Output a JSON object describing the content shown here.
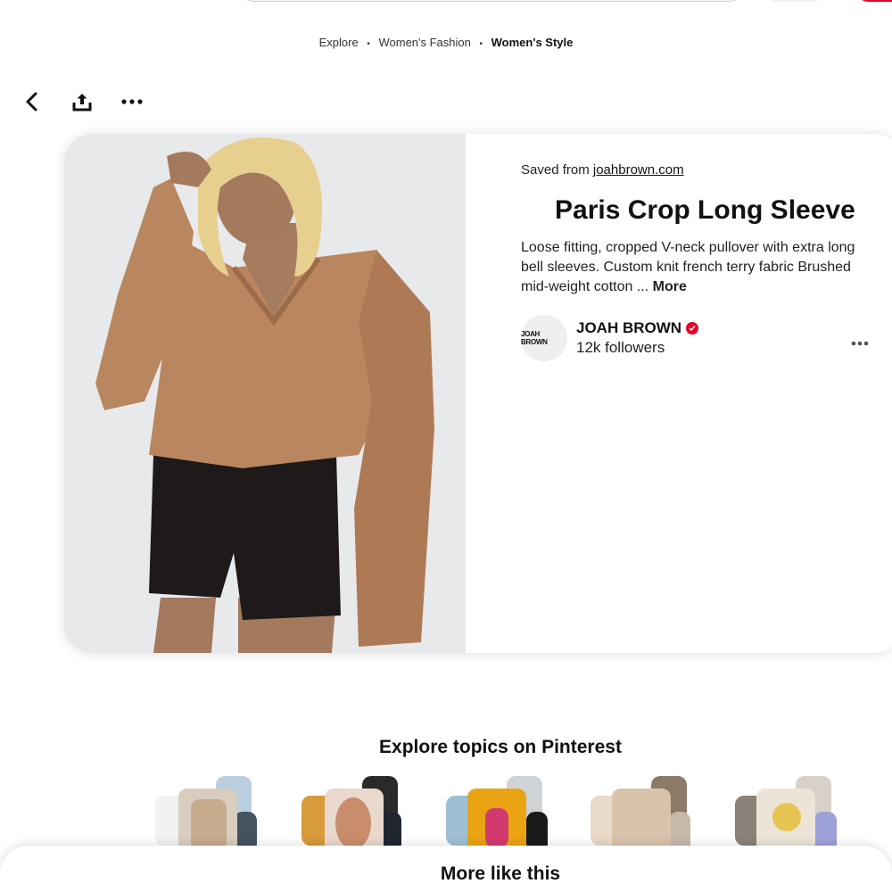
{
  "breadcrumb": {
    "items": [
      "Explore",
      "Women's Fashion"
    ],
    "current": "Women's Style"
  },
  "pin": {
    "saved_prefix": "Saved from",
    "source": "joahbrown.com",
    "title": "Paris Crop Long Sleeve",
    "description": "Loose fitting, cropped V-neck pullover with extra long bell sleeves. Custom knit french terry fabric Brushed mid-weight cotton ...",
    "more_label": "More"
  },
  "creator": {
    "avatar_text": "JOAH BROWN",
    "name": "JOAH BROWN",
    "followers": "12k followers"
  },
  "explore": {
    "title": "Explore topics on Pinterest"
  },
  "more_like_this": "More like this",
  "icons": {
    "back": "chevron-left-icon",
    "share": "share-icon",
    "more": "ellipsis-icon"
  },
  "colors": {
    "accent": "#e60023"
  }
}
